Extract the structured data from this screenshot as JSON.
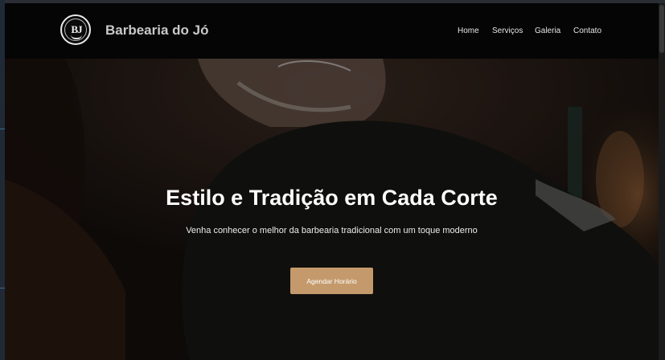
{
  "brand": {
    "logo_initials": "BJ",
    "name": "Barbearia do Jó"
  },
  "nav": {
    "items": [
      "Home",
      "Serviços",
      "Galeria",
      "Contato"
    ]
  },
  "hero": {
    "title": "Estilo e Tradição em Cada Corte",
    "subtitle": "Venha conhecer o melhor da barbearia tradicional com um toque moderno",
    "cta_label": "Agendar Horário",
    "image": "barber-cutting-hair-photo"
  },
  "colors": {
    "navbar_bg": "#050505",
    "accent": "#c49a6c",
    "text": "#ffffff"
  }
}
